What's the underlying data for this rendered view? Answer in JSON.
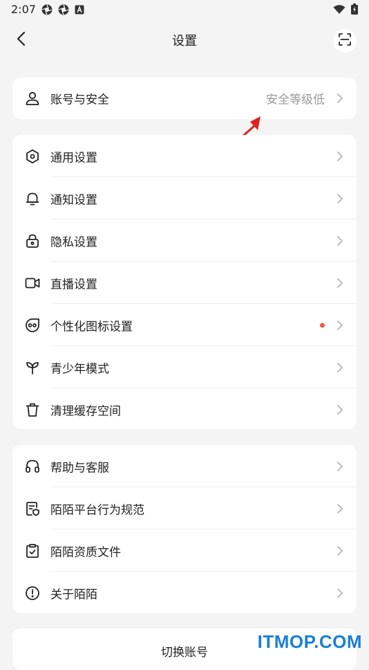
{
  "status_bar": {
    "time": "2:07"
  },
  "nav": {
    "title": "设置"
  },
  "account_card": {
    "label": "账号与安全",
    "value": "安全等级低"
  },
  "main_card": {
    "items": [
      {
        "label": "通用设置",
        "icon": "hexagon-settings-icon"
      },
      {
        "label": "通知设置",
        "icon": "bell-icon"
      },
      {
        "label": "隐私设置",
        "icon": "lock-icon"
      },
      {
        "label": "直播设置",
        "icon": "video-camera-icon"
      },
      {
        "label": "个性化图标设置",
        "icon": "face-icon",
        "has_dot": true
      },
      {
        "label": "青少年模式",
        "icon": "sprout-icon"
      },
      {
        "label": "清理缓存空间",
        "icon": "trash-icon"
      }
    ]
  },
  "help_card": {
    "items": [
      {
        "label": "帮助与客服",
        "icon": "headset-icon"
      },
      {
        "label": "陌陌平台行为规范",
        "icon": "document-shield-icon"
      },
      {
        "label": "陌陌资质文件",
        "icon": "clipboard-check-icon"
      },
      {
        "label": "关于陌陌",
        "icon": "info-exclamation-icon"
      }
    ]
  },
  "switch_account": {
    "label": "切换账号"
  },
  "watermark": {
    "text": "ITMOP.COM"
  },
  "colors": {
    "background": "#f4f4f4",
    "card": "#ffffff",
    "dot": "#f25a43",
    "annotation_arrow": "#e0201f",
    "watermark": "#1a7fd6"
  }
}
